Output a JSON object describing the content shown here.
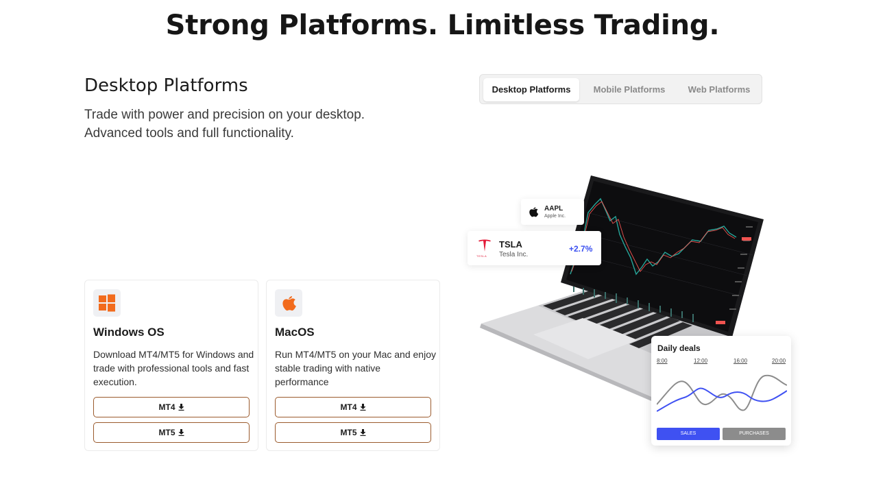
{
  "headline": "Strong Platforms. Limitless Trading.",
  "section": {
    "title": "Desktop Platforms",
    "description_line1": "Trade with power and precision on your desktop.",
    "description_line2": "Advanced tools and full functionality."
  },
  "tabs": [
    {
      "label": "Desktop Platforms",
      "active": true
    },
    {
      "label": "Mobile Platforms",
      "active": false
    },
    {
      "label": "Web Platforms",
      "active": false
    }
  ],
  "cards": [
    {
      "icon": "windows-icon",
      "title": "Windows OS",
      "text": "Download MT4/MT5 for Windows and trade with professional tools and fast execution.",
      "buttons": [
        "MT4",
        "MT5"
      ]
    },
    {
      "icon": "apple-icon",
      "title": "MacOS",
      "text": "Run MT4/MT5 on your Mac and enjoy stable trading with native performance",
      "buttons": [
        "MT4",
        "MT5"
      ]
    }
  ],
  "tickers": {
    "aapl": {
      "symbol": "AAPL",
      "company": "Apple Inc."
    },
    "tsla": {
      "symbol": "TSLA",
      "company": "Tesla Inc.",
      "change": "+2.7%",
      "logo_text": "TESLA"
    }
  },
  "daily_deals": {
    "title": "Daily deals",
    "times": [
      "8:00",
      "12:00",
      "16:00",
      "20:00"
    ],
    "sales_label": "SALES",
    "purchases_label": "PURCHASES"
  },
  "colors": {
    "accent_orange": "#f26b1d",
    "button_border": "#9a5a2c",
    "positive_blue": "#3a4ff0",
    "sales_blue": "#3f51f2",
    "purchases_gray": "#8c8c8c"
  }
}
